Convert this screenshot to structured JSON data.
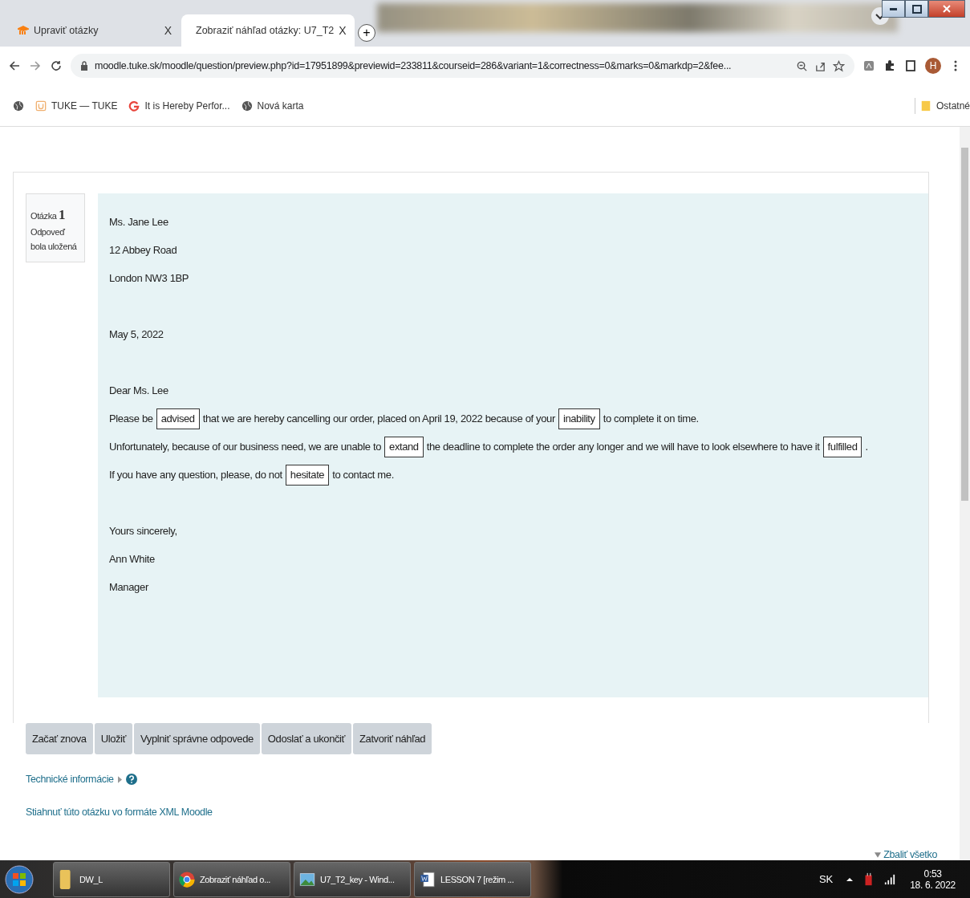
{
  "tabs": [
    {
      "title": "Upraviť otázky",
      "close": "X",
      "selected": false
    },
    {
      "title": "Zobraziť náhľad otázky: U7_T2",
      "close": "X",
      "selected": true
    }
  ],
  "new_tab": "+",
  "address_bar": {
    "url": "moodle.tuke.sk/moodle/question/preview.php?id=17951899&previewid=233811&courseid=286&variant=1&correctness=0&marks=0&markdp=2&fee..."
  },
  "profile": "H",
  "bookmarks": [
    {
      "label": "TUKE — TUKE",
      "kind": "tuke"
    },
    {
      "label": "It is Hereby Perfor...",
      "kind": "google"
    },
    {
      "label": "Nová karta",
      "kind": "globe"
    }
  ],
  "other_bookmarks": "Ostatné",
  "question_info": {
    "label": "Otázka",
    "number": "1",
    "state": "Odpoveď bola uložená"
  },
  "letter": [
    {
      "kind": "line",
      "parts": [
        {
          "kind": "text",
          "text": "Ms. Jane Lee"
        }
      ]
    },
    {
      "kind": "line",
      "parts": [
        {
          "kind": "text",
          "text": "12 Abbey Road"
        }
      ]
    },
    {
      "kind": "line",
      "parts": [
        {
          "kind": "text",
          "text": "London NW3 1BP"
        }
      ]
    },
    {
      "kind": "gap"
    },
    {
      "kind": "line",
      "parts": [
        {
          "kind": "text",
          "text": "May 5, 2022"
        }
      ]
    },
    {
      "kind": "gap"
    },
    {
      "kind": "line",
      "parts": [
        {
          "kind": "text",
          "text": "Dear Ms. Lee"
        }
      ]
    },
    {
      "kind": "line",
      "parts": [
        {
          "kind": "text",
          "text": "Please be"
        },
        {
          "kind": "answer",
          "text": "advised"
        },
        {
          "kind": "text",
          "text": "that we are hereby cancelling our order, placed on April 19, 2022 because of your"
        },
        {
          "kind": "answer",
          "text": "inability"
        },
        {
          "kind": "text",
          "text": "to complete it on time."
        }
      ]
    },
    {
      "kind": "line",
      "parts": [
        {
          "kind": "text",
          "text": "Unfortunately, because of our business need, we are unable to"
        },
        {
          "kind": "answer",
          "text": "extand"
        },
        {
          "kind": "text",
          "text": "the deadline to complete the order any longer and we will have to look elsewhere to have it"
        },
        {
          "kind": "answer",
          "text": "fulfilled"
        },
        {
          "kind": "text",
          "text": "."
        }
      ]
    },
    {
      "kind": "line",
      "parts": [
        {
          "kind": "text",
          "text": "If you have any question, please, do not"
        },
        {
          "kind": "answer",
          "text": "hesitate"
        },
        {
          "kind": "text",
          "text": "to contact me."
        }
      ]
    },
    {
      "kind": "gap"
    },
    {
      "kind": "line",
      "parts": [
        {
          "kind": "text",
          "text": "Yours sincerely,"
        }
      ]
    },
    {
      "kind": "line",
      "parts": [
        {
          "kind": "text",
          "text": "Ann White"
        }
      ]
    },
    {
      "kind": "line",
      "parts": [
        {
          "kind": "text",
          "text": "Manager"
        }
      ]
    }
  ],
  "buttons": [
    "Začať znova",
    "Uložiť",
    "Vyplniť správne odpovede",
    "Odoslať a ukončiť",
    "Zatvoriť náhľad"
  ],
  "technical_info": "Technické informácie",
  "download_link": "Stiahnuť túto otázku vo formáte XML Moodle",
  "collapse_all": "Zbaliť všetko",
  "taskbar": [
    {
      "label": "DW_L",
      "kind": "folder"
    },
    {
      "label": "Zobraziť náhľad o...",
      "kind": "chrome"
    },
    {
      "label": "U7_T2_key - Wind...",
      "kind": "image"
    },
    {
      "label": "LESSON 7 [režim ...",
      "kind": "word"
    }
  ],
  "tray": {
    "language": "SK",
    "time": "0:53",
    "date": "18. 6. 2022"
  }
}
